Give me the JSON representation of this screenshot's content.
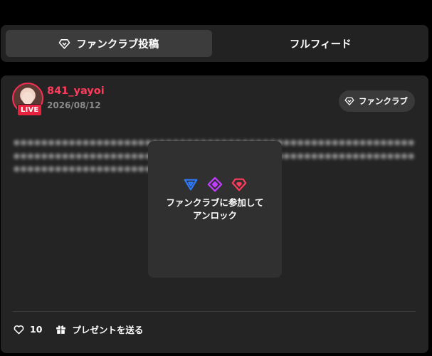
{
  "tabs": [
    {
      "label": "ファンクラブ投稿",
      "icon": "diamond-icon",
      "active": true
    },
    {
      "label": "フルフィード",
      "active": false
    }
  ],
  "post": {
    "username": "841_yayoi",
    "date": "2026/08/12",
    "live_badge": "LIVE",
    "fanclub_badge": "ファンクラブ",
    "locked_text": "ファンクラブに参加して\nアンロック",
    "lock_icons": [
      {
        "name": "triangle-icon",
        "color": "#2f7bff"
      },
      {
        "name": "diamond-icon",
        "color": "#c23cff"
      },
      {
        "name": "heart-diamond-icon",
        "color": "#ff3b5c"
      }
    ],
    "likes": "10",
    "gift_label": "プレゼントを送る"
  },
  "colors": {
    "accent": "#ff3b5c",
    "background": "#000000",
    "card": "#242424"
  }
}
